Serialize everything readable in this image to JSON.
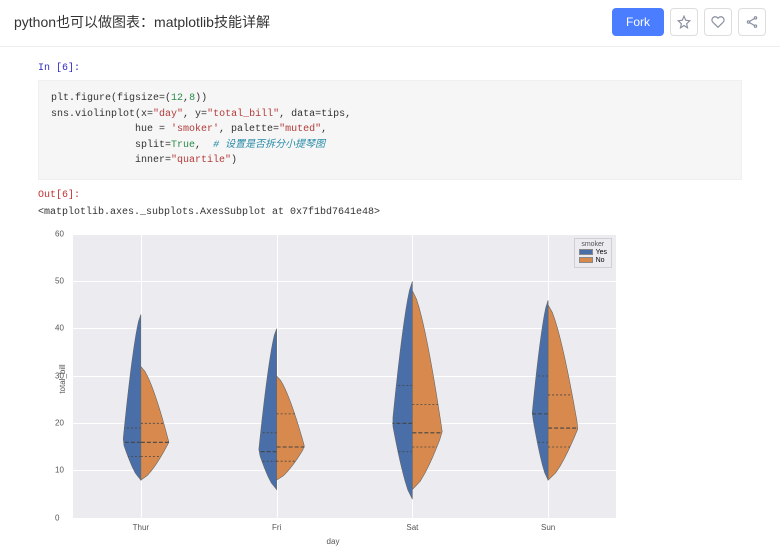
{
  "header": {
    "title": "python也可以做图表：matplotlib技能详解",
    "fork_label": "Fork"
  },
  "prompts": {
    "in": "In [6]:",
    "out": "Out[6]:"
  },
  "code": {
    "l1_a": "plt.figure(figsize=(",
    "l1_b": "12",
    "l1_c": ",",
    "l1_d": "8",
    "l1_e": "))",
    "l2_a": "sns.violinplot(x=",
    "l2_b": "\"day\"",
    "l2_c": ", y=",
    "l2_d": "\"total_bill\"",
    "l2_e": ", data=tips,",
    "l3_a": "              hue = ",
    "l3_b": "'smoker'",
    "l3_c": ", palette=",
    "l3_d": "\"muted\"",
    "l3_e": ",",
    "l4_a": "              split=",
    "l4_b": "True",
    "l4_c": ",  ",
    "l4_d": "# 设置是否拆分小提琴图",
    "l5_a": "              inner=",
    "l5_b": "\"quartile\"",
    "l5_c": ")"
  },
  "output_text": "<matplotlib.axes._subplots.AxesSubplot at 0x7f1bd7641e48>",
  "chart_data": {
    "type": "violin-split",
    "xlabel": "day",
    "ylabel": "total_bill",
    "ylim": [
      0,
      60
    ],
    "yticks": [
      0,
      10,
      20,
      30,
      40,
      50,
      60
    ],
    "categories": [
      "Thur",
      "Fri",
      "Sat",
      "Sun"
    ],
    "legend": {
      "title": "smoker",
      "entries": [
        "Yes",
        "No"
      ],
      "colors": [
        "#4a6fa8",
        "#d88a4e"
      ]
    },
    "series": [
      {
        "category": "Thur",
        "smoker": "Yes",
        "min": 8,
        "q1": 13,
        "median": 16,
        "q3": 19,
        "max": 43,
        "max_width": 18
      },
      {
        "category": "Thur",
        "smoker": "No",
        "min": 8,
        "q1": 13,
        "median": 16,
        "q3": 20,
        "max": 32,
        "max_width": 28
      },
      {
        "category": "Fri",
        "smoker": "Yes",
        "min": 6,
        "q1": 12,
        "median": 14,
        "q3": 18,
        "max": 40,
        "max_width": 18
      },
      {
        "category": "Fri",
        "smoker": "No",
        "min": 8,
        "q1": 12,
        "median": 15,
        "q3": 22,
        "max": 30,
        "max_width": 28
      },
      {
        "category": "Sat",
        "smoker": "Yes",
        "min": 4,
        "q1": 14,
        "median": 20,
        "q3": 28,
        "max": 50,
        "max_width": 20
      },
      {
        "category": "Sat",
        "smoker": "No",
        "min": 6,
        "q1": 15,
        "median": 18,
        "q3": 24,
        "max": 48,
        "max_width": 30
      },
      {
        "category": "Sun",
        "smoker": "Yes",
        "min": 8,
        "q1": 16,
        "median": 22,
        "q3": 30,
        "max": 46,
        "max_width": 16
      },
      {
        "category": "Sun",
        "smoker": "No",
        "min": 8,
        "q1": 15,
        "median": 19,
        "q3": 26,
        "max": 45,
        "max_width": 30
      }
    ]
  }
}
